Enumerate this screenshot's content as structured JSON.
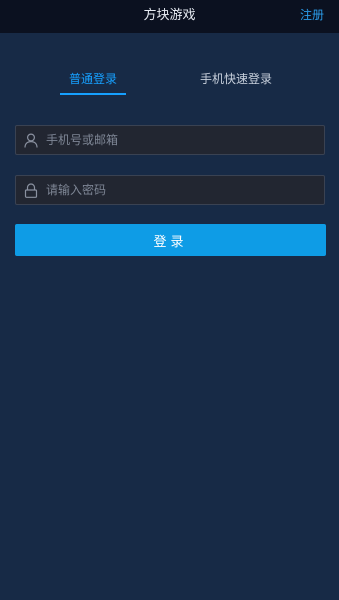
{
  "header": {
    "title": "方块游戏",
    "register_label": "注册"
  },
  "tabs": [
    {
      "label": "普通登录",
      "active": true
    },
    {
      "label": "手机快速登录",
      "active": false
    }
  ],
  "form": {
    "account": {
      "placeholder": "手机号或邮箱",
      "value": "",
      "icon": "user-icon"
    },
    "password": {
      "placeholder": "请输入密码",
      "value": "",
      "icon": "lock-icon"
    },
    "login_label": "登录"
  },
  "colors": {
    "background": "#172a46",
    "topbar": "#0b1120",
    "accent": "#16a0ff",
    "button": "#0e9ce6",
    "field_bg": "#222631"
  }
}
